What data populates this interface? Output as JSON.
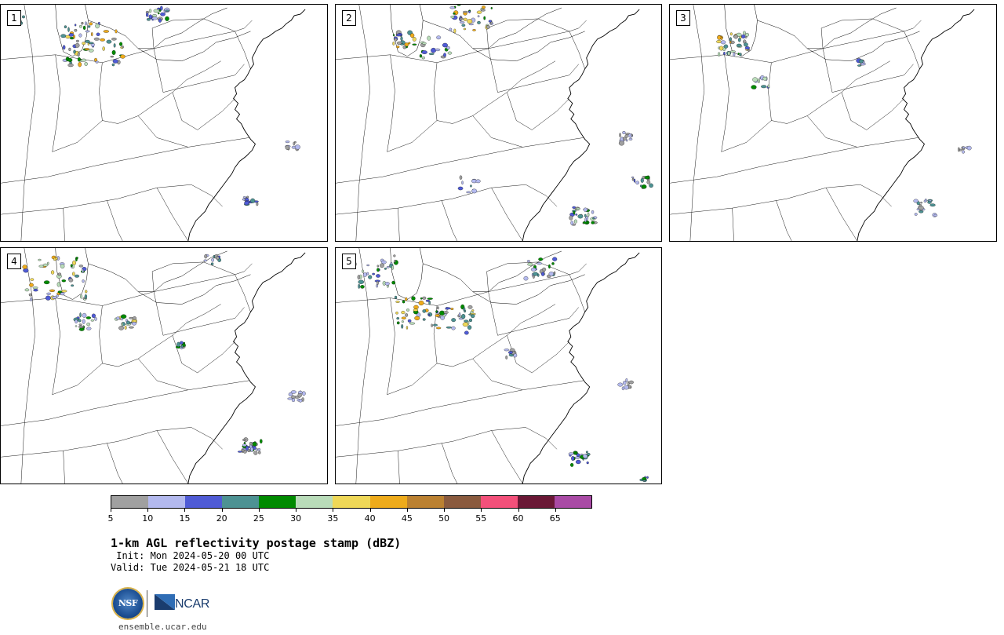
{
  "panels": [
    {
      "label": "1"
    },
    {
      "label": "2"
    },
    {
      "label": "3"
    },
    {
      "label": "4"
    },
    {
      "label": "5"
    }
  ],
  "colorbar": {
    "ticks": [
      "5",
      "10",
      "15",
      "20",
      "25",
      "30",
      "35",
      "40",
      "45",
      "50",
      "55",
      "60",
      "65"
    ],
    "colors": [
      "#a0a0a0",
      "#b3b9ee",
      "#4f5bd5",
      "#4d9293",
      "#008a00",
      "#b9dcb9",
      "#efd858",
      "#eeab1b",
      "#bb8131",
      "#8a5a3e",
      "#f3507a",
      "#6a1836",
      "#a94aa5"
    ]
  },
  "title": "1-km AGL reflectivity postage stamp (dBZ)",
  "init": " Init: Mon 2024-05-20 00 UTC",
  "valid": "Valid: Tue 2024-05-21 18 UTC",
  "logos": {
    "nsf_text": "NSF",
    "ncar_text": "NCAR",
    "colors": {
      "nsf_blue": "#1c4f93",
      "ncar_blue": "#1a3c6e"
    }
  },
  "site": "ensemble.ucar.edu"
}
